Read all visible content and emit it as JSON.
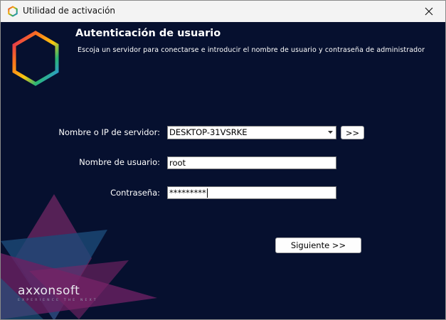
{
  "window": {
    "title": "Utilidad de activación",
    "icon": "axxon-hexagon-icon",
    "close_icon": "close-icon"
  },
  "header": {
    "title": "Autenticación de usuario",
    "subtitle": "Escoja un servidor para conectarse e introducir el nombre de usuario y contraseña de administrador"
  },
  "form": {
    "server_label": "Nombre o IP de servidor:",
    "server_value": "DESKTOP-31VSRKE",
    "browse_label": ">>",
    "username_label": "Nombre de usuario:",
    "username_value": "root",
    "password_label": "Contraseña:",
    "password_value": "*********"
  },
  "actions": {
    "next_label": "Siguiente >>"
  },
  "brand": {
    "name": "axxonsoft",
    "tagline": "EXPERIENCE THE NEXT"
  },
  "colors": {
    "background": "#06102f",
    "accent_magenta": "#8b2a6c",
    "accent_teal": "#1b5c7a"
  }
}
